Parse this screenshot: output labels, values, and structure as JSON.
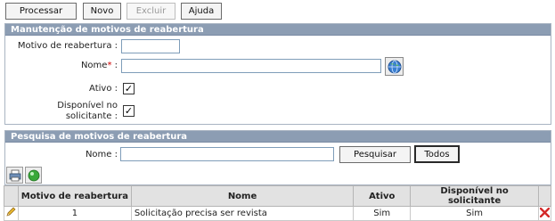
{
  "toolbar": {
    "processar": "Processar",
    "novo": "Novo",
    "excluir": "Excluir",
    "ajuda": "Ajuda"
  },
  "maintenance": {
    "title": "Manutenção de motivos de reabertura",
    "motivo_label": "Motivo de reabertura :",
    "motivo_value": "",
    "nome_label": "Nome",
    "nome_suffix": " :",
    "required_mark": "*",
    "nome_value": "",
    "ativo_label": "Ativo :",
    "ativo_checked": true,
    "disponivel_label_line1": "Disponível no",
    "disponivel_label_line2": "solicitante :",
    "disponivel_checked": true
  },
  "search": {
    "title": "Pesquisa de motivos de reabertura",
    "nome_label": "Nome :",
    "nome_value": "",
    "pesquisar": "Pesquisar",
    "todos": "Todos"
  },
  "grid": {
    "columns": [
      "",
      "Motivo de reabertura",
      "Nome",
      "Ativo",
      "Disponível no solicitante",
      ""
    ],
    "rows": [
      {
        "motivo": "1",
        "nome": "Solicitação precisa ser revista",
        "ativo": "Sim",
        "disponivel": "Sim"
      }
    ]
  },
  "icons": {
    "globe": "globe-icon",
    "pencil": "pencil-icon",
    "delete": "delete-x-icon",
    "print": "print-icon",
    "refresh": "refresh-icon"
  },
  "colors": {
    "panel_header": "#8c9db3",
    "required": "#cc0000",
    "delete": "#d42a2a"
  }
}
